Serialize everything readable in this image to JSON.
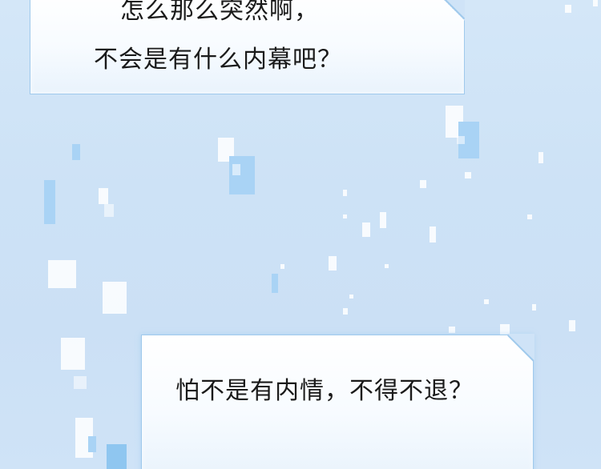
{
  "dialogue": {
    "bubble_top": {
      "lines": [
        "怎么那么突然啊，",
        "不会是有什么内幕吧？"
      ]
    },
    "bubble_bottom": {
      "lines": [
        "怕不是有内情，不得不退？"
      ]
    }
  },
  "colors": {
    "background": "#cfe3f7",
    "bubble_border": "#9fc9ec",
    "text": "#1a1a1a",
    "pixel_accent": "#a9d3f5"
  }
}
